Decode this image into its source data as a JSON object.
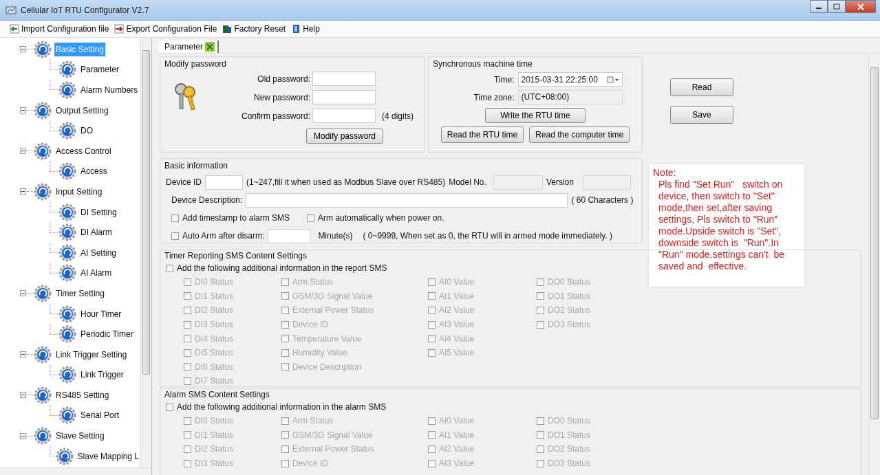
{
  "window": {
    "title": "Cellular IoT RTU Configurator V2.7"
  },
  "toolbar": [
    {
      "label": "Import Configuration file",
      "kind": "import"
    },
    {
      "label": "Export Configuration File",
      "kind": "export"
    },
    {
      "label": "Factory Reset",
      "kind": "reset"
    },
    {
      "label": "Help",
      "kind": "help"
    }
  ],
  "tree": [
    {
      "label": "Basic Setting",
      "selected": true,
      "expanded": true,
      "children": [
        {
          "label": "Parameter",
          "selected": false
        },
        {
          "label": "Alarm Numbers",
          "selected": false
        }
      ]
    },
    {
      "label": "Output Setting",
      "selected": false,
      "expanded": true,
      "children": [
        {
          "label": "DO",
          "selected": false
        }
      ]
    },
    {
      "label": "Access Control",
      "selected": false,
      "expanded": true,
      "children": [
        {
          "label": "Access",
          "selected": false
        }
      ]
    },
    {
      "label": "Input Setting",
      "selected": false,
      "expanded": true,
      "children": [
        {
          "label": "DI Setting",
          "selected": false
        },
        {
          "label": "DI Alarm",
          "selected": false
        },
        {
          "label": "AI  Setting",
          "selected": false
        },
        {
          "label": "AI Alarm",
          "selected": false
        }
      ]
    },
    {
      "label": "Timer Setting",
      "selected": false,
      "expanded": true,
      "children": [
        {
          "label": "Hour Timer",
          "selected": false
        },
        {
          "label": "Periodic Timer",
          "selected": false
        }
      ]
    },
    {
      "label": "Link Trigger Setting",
      "selected": false,
      "expanded": true,
      "children": [
        {
          "label": "Link Trigger",
          "selected": false
        }
      ]
    },
    {
      "label": "RS485 Setting",
      "selected": false,
      "expanded": true,
      "children": [
        {
          "label": "Serial Port",
          "selected": false
        }
      ]
    },
    {
      "label": "Slave Setting",
      "selected": false,
      "expanded": true,
      "children": [
        {
          "label": "Slave Mapping L",
          "selected": false
        }
      ]
    }
  ],
  "tabs": [
    {
      "label": "Parameter",
      "selected": true
    }
  ],
  "modify_password": {
    "title": "Modify password",
    "fields": [
      {
        "label": "Old password:"
      },
      {
        "label": "New password:"
      },
      {
        "label": "Confirm password:",
        "hint": "(4 digits)"
      }
    ],
    "button": "Modify password"
  },
  "machine_time": {
    "title": "Synchronous machine time",
    "time_label": "Time:",
    "time_value": "2015-03-31 22:25:00",
    "zone_label": "Time zone:",
    "zone_value": "(UTC+08:00)",
    "write_button": "Write the RTU time",
    "read_buttons": [
      "Read the RTU time",
      "Read the computer time"
    ]
  },
  "actions": [
    "Read",
    "Save"
  ],
  "basic_info": {
    "title": "Basic information",
    "device_id_label": "Device ID",
    "device_id_hint": "(1~247,fill it when used as Modbus Slave over RS485)",
    "model_label": "Model No.",
    "version_label": "Version",
    "description_label": "Device Description:",
    "description_hint": "( 60 Characters )",
    "options": [
      {
        "label": "Add timestamp to alarm SMS",
        "checked": false
      },
      {
        "label": "Arm automatically when power on.",
        "checked": false
      }
    ],
    "auto_arm": {
      "label": "Auto Arm after disarm:",
      "checked": false,
      "unit": "Minute(s)",
      "hint": "( 0~9999, When set as 0, the RTU will in armed mode immediately. )"
    }
  },
  "note": {
    "title": "Note:",
    "text": "Pls find \"Set Run\"   switch on device, then switch to \"Set\" mode,then set,after saving settings, Pls switch to \"Run\" mode.Upside switch is \"Set\", downside switch is  \"Run\".In \"Run\" mode,settings can't  be saved and  effective."
  },
  "timer_sms": {
    "title": "Timer Reporting SMS Content Settings",
    "master": {
      "label": "Add the following additional information in the report SMS",
      "checked": false
    },
    "columns": [
      {
        "items": [
          {
            "label": "DI0 Status",
            "checked": false,
            "disabled": true
          },
          {
            "label": "DI1 Status",
            "checked": false,
            "disabled": true
          },
          {
            "label": "DI2 Status",
            "checked": false,
            "disabled": true
          },
          {
            "label": "DI3 Status",
            "checked": false,
            "disabled": true
          },
          {
            "label": "DI4 Status",
            "checked": false,
            "disabled": true
          },
          {
            "label": "DI5 Status",
            "checked": false,
            "disabled": true
          },
          {
            "label": "DI6 Status",
            "checked": false,
            "disabled": true
          },
          {
            "label": "DI7 Status",
            "checked": false,
            "disabled": true
          }
        ]
      },
      {
        "items": [
          {
            "label": "Arm Status",
            "checked": false,
            "disabled": true
          },
          {
            "label": "GSM/3G Signal Value",
            "checked": false,
            "disabled": true
          },
          {
            "label": "External Power Status",
            "checked": false,
            "disabled": true
          },
          {
            "label": "Device ID",
            "checked": false,
            "disabled": true
          },
          {
            "label": "Temperature Value",
            "checked": false,
            "disabled": true
          },
          {
            "label": "Humidity Value",
            "checked": false,
            "disabled": true
          },
          {
            "label": "Device Description",
            "checked": false,
            "disabled": true
          }
        ]
      },
      {
        "items": [
          {
            "label": "AI0 Value",
            "checked": false,
            "disabled": true
          },
          {
            "label": "AI1 Value",
            "checked": false,
            "disabled": true
          },
          {
            "label": "AI2 Value",
            "checked": false,
            "disabled": true
          },
          {
            "label": "AI3 Value",
            "checked": false,
            "disabled": true
          },
          {
            "label": "AI4 Value",
            "checked": false,
            "disabled": true
          },
          {
            "label": "AI5 Value",
            "checked": false,
            "disabled": true
          }
        ]
      },
      {
        "items": [
          {
            "label": "DO0 Status",
            "checked": false,
            "disabled": true
          },
          {
            "label": "DO1 Status",
            "checked": false,
            "disabled": true
          },
          {
            "label": "DO2 Status",
            "checked": false,
            "disabled": true
          },
          {
            "label": "DO3 Status",
            "checked": false,
            "disabled": true
          }
        ]
      }
    ]
  },
  "alarm_sms": {
    "title": "Alarm SMS Content Settings",
    "master": {
      "label": "Add the following additional information in the alarm SMS",
      "checked": false
    },
    "columns": [
      {
        "items": [
          {
            "label": "DI0 Status",
            "checked": false,
            "disabled": true
          },
          {
            "label": "DI1 Status",
            "checked": false,
            "disabled": true
          },
          {
            "label": "DI2 Status",
            "checked": false,
            "disabled": true
          },
          {
            "label": "DI3 Status",
            "checked": false,
            "disabled": true
          }
        ]
      },
      {
        "items": [
          {
            "label": "Arm Status",
            "checked": false,
            "disabled": true
          },
          {
            "label": "GSM/3G Signal Value",
            "checked": false,
            "disabled": true
          },
          {
            "label": "External Power Status",
            "checked": false,
            "disabled": true
          },
          {
            "label": "Device ID",
            "checked": false,
            "disabled": true
          }
        ]
      },
      {
        "items": [
          {
            "label": "AI0 Value",
            "checked": false,
            "disabled": true
          },
          {
            "label": "AI1 Value",
            "checked": false,
            "disabled": true
          },
          {
            "label": "AI2 Value",
            "checked": false,
            "disabled": true
          },
          {
            "label": "AI3 Value",
            "checked": false,
            "disabled": true
          }
        ]
      },
      {
        "items": [
          {
            "label": "DO0 Status",
            "checked": false,
            "disabled": true
          },
          {
            "label": "DO1 Status",
            "checked": false,
            "disabled": true
          },
          {
            "label": "DO2 Status",
            "checked": false,
            "disabled": true
          },
          {
            "label": "DO3 Status",
            "checked": false,
            "disabled": true
          }
        ]
      }
    ]
  }
}
